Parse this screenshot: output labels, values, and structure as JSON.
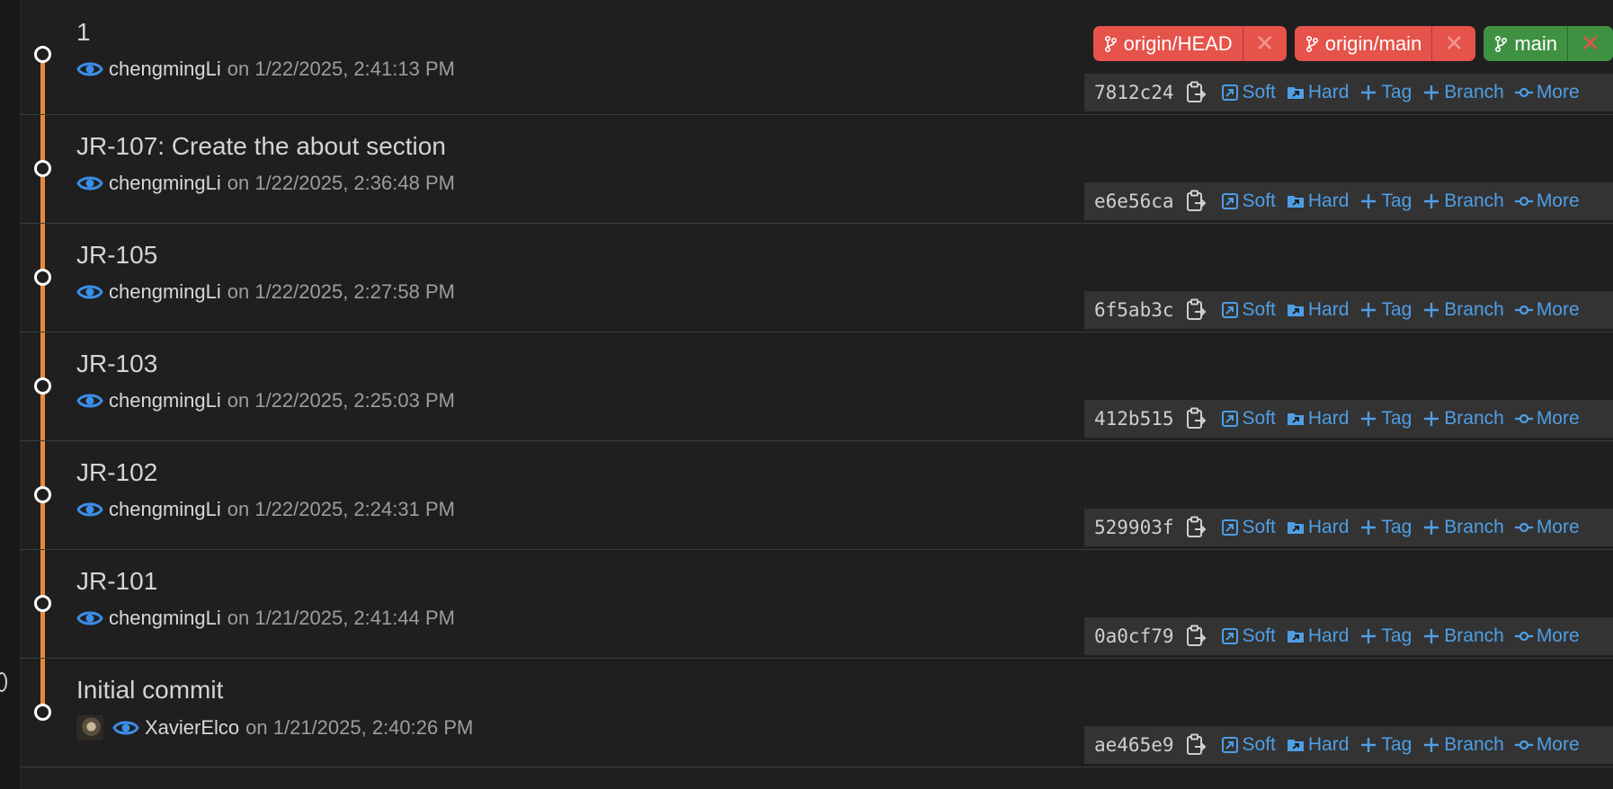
{
  "commits": [
    {
      "title": "1",
      "author": "chengmingLi",
      "date_text": "on 1/22/2025, 2:41:13 PM",
      "hash": "7812c24",
      "has_avatar": false,
      "refs": [
        {
          "name": "origin/HEAD",
          "color": "#e5534b"
        },
        {
          "name": "origin/main",
          "color": "#e5534b"
        },
        {
          "name": "main",
          "color": "#3f9142"
        }
      ]
    },
    {
      "title": "JR-107: Create the about section",
      "author": "chengmingLi",
      "date_text": "on 1/22/2025, 2:36:48 PM",
      "hash": "e6e56ca",
      "has_avatar": false
    },
    {
      "title": "JR-105",
      "author": "chengmingLi",
      "date_text": "on 1/22/2025, 2:27:58 PM",
      "hash": "6f5ab3c",
      "has_avatar": false
    },
    {
      "title": "JR-103",
      "author": "chengmingLi",
      "date_text": "on 1/22/2025, 2:25:03 PM",
      "hash": "412b515",
      "has_avatar": false
    },
    {
      "title": "JR-102",
      "author": "chengmingLi",
      "date_text": "on 1/22/2025, 2:24:31 PM",
      "hash": "529903f",
      "has_avatar": false
    },
    {
      "title": "JR-101",
      "author": "chengmingLi",
      "date_text": "on 1/21/2025, 2:41:44 PM",
      "hash": "0a0cf79",
      "has_avatar": false
    },
    {
      "title": "Initial commit",
      "author": "XavierElco",
      "date_text": "on 1/21/2025, 2:40:26 PM",
      "hash": "ae465e9",
      "has_avatar": true
    }
  ],
  "actions": {
    "soft": "Soft",
    "hard": "Hard",
    "tag": "Tag",
    "branch": "Branch",
    "more": "More"
  },
  "ref_close_glyph": "✕",
  "colors": {
    "graph_line": "#e8883a",
    "action_link": "#4f9ee5",
    "ref_remote": "#e5534b",
    "ref_local": "#3f9142",
    "action_bar_bg": "#333333"
  },
  "icons": {
    "view": "eye-icon",
    "copy": "clipboard-copy-icon",
    "soft": "soft-reset-icon",
    "hard": "hard-reset-icon",
    "tag": "plus-icon",
    "branch": "plus-icon",
    "more": "commit-icon",
    "ref": "git-branch-icon",
    "ref_close": "close-icon"
  }
}
